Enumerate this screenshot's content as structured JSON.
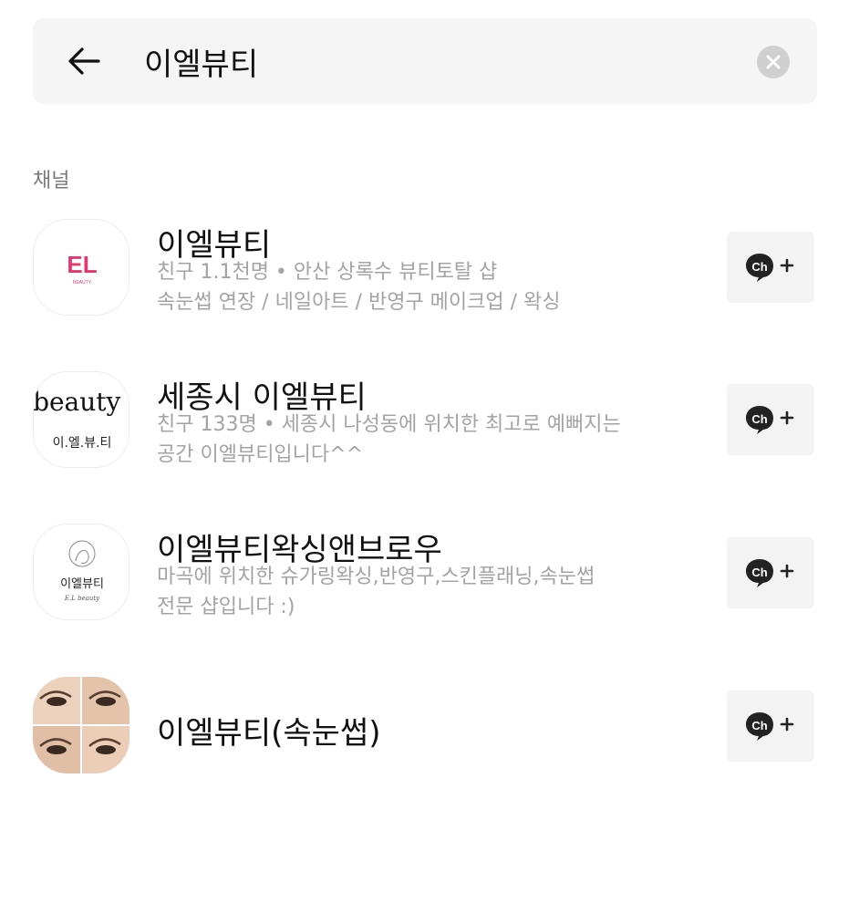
{
  "search": {
    "query": "이엘뷰티"
  },
  "section": {
    "label": "채널"
  },
  "channels": [
    {
      "name": "이엘뷰티",
      "description_line1": "친구 1.1천명 • 안산 상록수 뷰티토탈 샵",
      "description_line2": "속눈썹 연장 / 네일아트 / 반영구 메이크업 / 왁싱",
      "logo_text": "EL",
      "logo_subtext": "BEAUTY",
      "logo_color": "#e8356d"
    },
    {
      "name": "세종시 이엘뷰티",
      "description_line1": "친구 133명 • 세종시 나성동에 위치한 최고로 예뻐지는",
      "description_line2": "공간 이엘뷰티입니다^^",
      "logo_text": "el beauty",
      "logo_subtext": "이.엘.뷰.티"
    },
    {
      "name": "이엘뷰티왁싱앤브로우",
      "description_line1": "마곡에 위치한 슈가링왁싱,반영구,스킨플래닝,속눈썹",
      "description_line2": "전문 샵입니다 :)",
      "logo_text": "이엘뷰티",
      "logo_subtext": "E.L beauty"
    },
    {
      "name": "이엘뷰티(속눈썹)",
      "description_line1": "",
      "description_line2": ""
    }
  ],
  "add_button": {
    "label": "Ch"
  },
  "colors": {
    "background": "#ffffff",
    "search_bg": "#f5f5f5",
    "secondary_text": "#a3a3a3",
    "button_bg": "#f3f3f3",
    "ch_icon": "#222222"
  }
}
